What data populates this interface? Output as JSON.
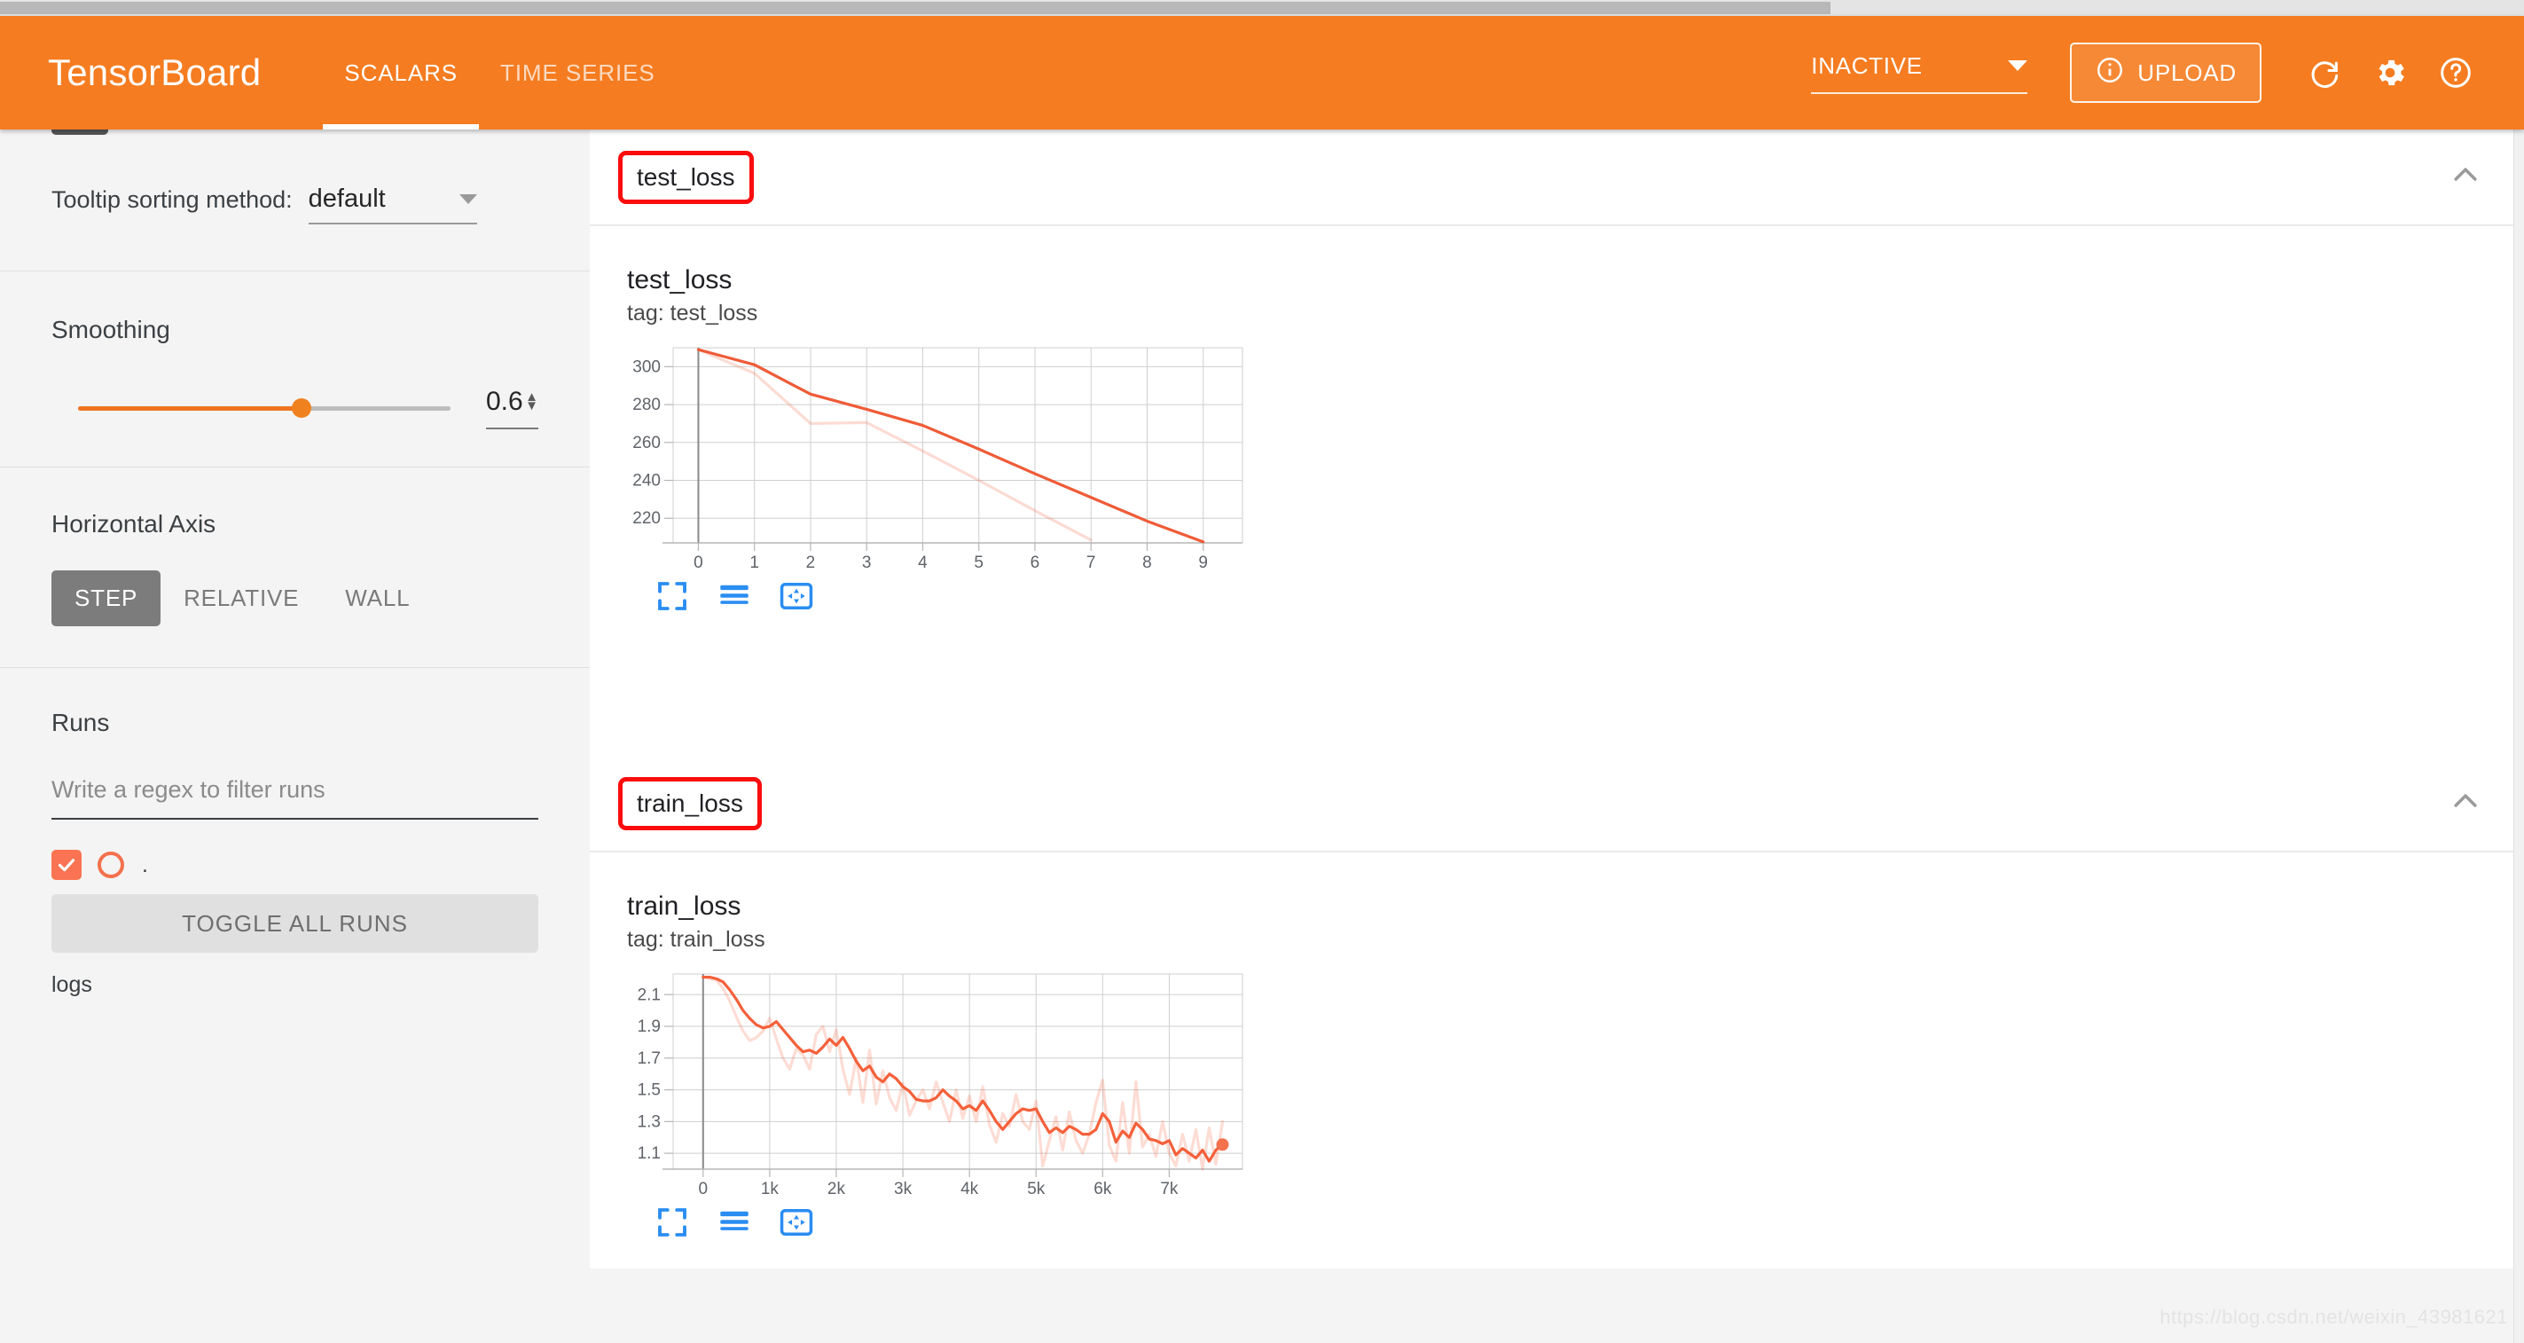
{
  "browser": {
    "top_scrollbar": "horizontal-scrollbar"
  },
  "header": {
    "brand": "TensorBoard",
    "tabs": [
      {
        "label": "SCALARS",
        "active": true
      },
      {
        "label": "TIME SERIES",
        "active": false
      }
    ],
    "status_select": {
      "value": "INACTIVE"
    },
    "upload_label": "UPLOAD",
    "icons": [
      {
        "name": "refresh-icon"
      },
      {
        "name": "settings-gear-icon"
      },
      {
        "name": "help-question-icon"
      }
    ],
    "accent_color": "#f57c20"
  },
  "sidebar": {
    "tooltip_sorting": {
      "label": "Tooltip sorting method:",
      "value": "default"
    },
    "smoothing": {
      "title": "Smoothing",
      "value": "0.6",
      "slider_percent": 60
    },
    "horizontal_axis": {
      "title": "Horizontal Axis",
      "options": [
        {
          "label": "STEP",
          "active": true
        },
        {
          "label": "RELATIVE",
          "active": false
        },
        {
          "label": "WALL",
          "active": false
        }
      ]
    },
    "runs": {
      "title": "Runs",
      "filter_placeholder": "Write a regex to filter runs",
      "filter_value": "",
      "run_items": [
        {
          "name": ".",
          "checked": true,
          "color": "#f4714e"
        }
      ],
      "toggle_all_label": "TOGGLE ALL RUNS",
      "logs_label": "logs"
    }
  },
  "main": {
    "sections": [
      {
        "tag_name": "test_loss",
        "chart": {
          "title": "test_loss",
          "subtitle": "tag: test_loss"
        }
      },
      {
        "tag_name": "train_loss",
        "chart": {
          "title": "train_loss",
          "subtitle": "tag: train_loss"
        }
      }
    ]
  },
  "watermark": "https://blog.csdn.net/weixin_43981621",
  "chart_data": [
    {
      "type": "line",
      "title": "test_loss",
      "subtitle": "tag: test_loss",
      "xlabel": "",
      "ylabel": "",
      "xlim": [
        -0.45,
        9.7
      ],
      "ylim": [
        207,
        310
      ],
      "xticks": [
        0,
        1,
        2,
        3,
        4,
        5,
        6,
        7,
        8,
        9
      ],
      "xticklabels": [
        "0",
        "1",
        "2",
        "3",
        "4",
        "5",
        "6",
        "7",
        "8",
        "9"
      ],
      "yticks": [
        220,
        240,
        260,
        280,
        300
      ],
      "yticklabels": [
        "220",
        "240",
        "260",
        "280",
        "300"
      ],
      "grid": true,
      "legend": false,
      "series": [
        {
          "name": "test_loss (smoothed)",
          "color": "#ef5b37",
          "opacity": 1,
          "x": [
            0,
            1,
            2,
            3,
            4,
            5,
            6,
            7,
            8,
            9
          ],
          "values": [
            309,
            301,
            285.5,
            277.5,
            269,
            256.5,
            243.5,
            231,
            218.5,
            207.5
          ]
        },
        {
          "name": "test_loss (raw)",
          "color": "#ef5b37",
          "opacity": 0.22,
          "x": [
            0,
            1,
            2,
            3,
            4,
            5,
            6,
            7
          ],
          "values": [
            309,
            296.5,
            270,
            270.5,
            255.5,
            240,
            224,
            208.5
          ]
        }
      ]
    },
    {
      "type": "line",
      "title": "train_loss",
      "subtitle": "tag: train_loss",
      "xlabel": "",
      "ylabel": "",
      "xlim": [
        -450,
        8100
      ],
      "ylim": [
        1.0,
        2.23
      ],
      "xticks": [
        0,
        1000,
        2000,
        3000,
        4000,
        5000,
        6000,
        7000
      ],
      "xticklabels": [
        "0",
        "1k",
        "2k",
        "3k",
        "4k",
        "5k",
        "6k",
        "7k"
      ],
      "yticks": [
        1.1,
        1.3,
        1.5,
        1.7,
        1.9,
        2.1
      ],
      "yticklabels": [
        "1.1",
        "1.3",
        "1.5",
        "1.7",
        "1.9",
        "2.1"
      ],
      "grid": true,
      "legend": false,
      "last_point_marker": {
        "x": 7800,
        "y": 1.155,
        "color": "#f4714e"
      },
      "series": [
        {
          "name": "train_loss (smoothed)",
          "color": "#f4603a",
          "opacity": 1,
          "x": [
            0,
            100,
            200,
            300,
            400,
            500,
            600,
            700,
            800,
            900,
            1000,
            1100,
            1200,
            1300,
            1400,
            1500,
            1600,
            1700,
            1800,
            1900,
            2000,
            2100,
            2200,
            2300,
            2400,
            2500,
            2600,
            2700,
            2800,
            2900,
            3000,
            3100,
            3200,
            3300,
            3400,
            3500,
            3600,
            3700,
            3800,
            3900,
            4000,
            4100,
            4200,
            4300,
            4400,
            4500,
            4600,
            4700,
            4800,
            4900,
            5000,
            5100,
            5200,
            5300,
            5400,
            5500,
            5600,
            5700,
            5800,
            5900,
            6000,
            6100,
            6200,
            6300,
            6400,
            6500,
            6600,
            6700,
            6800,
            6900,
            7000,
            7100,
            7200,
            7300,
            7400,
            7500,
            7600,
            7700,
            7800
          ],
          "values": [
            2.21,
            2.21,
            2.2,
            2.18,
            2.13,
            2.07,
            2.0,
            1.95,
            1.91,
            1.89,
            1.9,
            1.93,
            1.88,
            1.83,
            1.78,
            1.74,
            1.75,
            1.73,
            1.77,
            1.82,
            1.78,
            1.83,
            1.76,
            1.68,
            1.62,
            1.65,
            1.58,
            1.55,
            1.6,
            1.57,
            1.52,
            1.49,
            1.44,
            1.43,
            1.43,
            1.45,
            1.5,
            1.46,
            1.43,
            1.38,
            1.4,
            1.37,
            1.43,
            1.37,
            1.3,
            1.25,
            1.3,
            1.35,
            1.38,
            1.37,
            1.38,
            1.3,
            1.23,
            1.26,
            1.23,
            1.27,
            1.25,
            1.22,
            1.22,
            1.25,
            1.35,
            1.3,
            1.17,
            1.24,
            1.2,
            1.29,
            1.25,
            1.19,
            1.18,
            1.16,
            1.18,
            1.09,
            1.13,
            1.1,
            1.07,
            1.12,
            1.05,
            1.12,
            1.16
          ]
        },
        {
          "name": "train_loss (raw)",
          "color": "#f4603a",
          "opacity": 0.22,
          "x": [
            0,
            100,
            200,
            300,
            400,
            500,
            600,
            700,
            800,
            900,
            1000,
            1100,
            1200,
            1300,
            1400,
            1500,
            1600,
            1700,
            1800,
            1900,
            2000,
            2100,
            2200,
            2300,
            2400,
            2500,
            2600,
            2700,
            2800,
            2900,
            3000,
            3100,
            3200,
            3300,
            3400,
            3500,
            3600,
            3700,
            3800,
            3900,
            4000,
            4100,
            4200,
            4300,
            4400,
            4500,
            4600,
            4700,
            4800,
            4900,
            5000,
            5100,
            5200,
            5300,
            5400,
            5500,
            5600,
            5700,
            5800,
            5900,
            6000,
            6100,
            6200,
            6300,
            6400,
            6500,
            6600,
            6700,
            6800,
            6900,
            7000,
            7100,
            7200,
            7300,
            7400,
            7500,
            7600,
            7700,
            7800
          ],
          "values": [
            2.21,
            2.2,
            2.19,
            2.14,
            2.06,
            1.96,
            1.87,
            1.81,
            1.83,
            1.87,
            1.95,
            1.82,
            1.7,
            1.63,
            1.76,
            1.72,
            1.63,
            1.85,
            1.9,
            1.74,
            1.88,
            1.63,
            1.47,
            1.7,
            1.42,
            1.75,
            1.41,
            1.62,
            1.45,
            1.37,
            1.54,
            1.34,
            1.43,
            1.5,
            1.38,
            1.55,
            1.42,
            1.3,
            1.5,
            1.32,
            1.46,
            1.3,
            1.52,
            1.28,
            1.17,
            1.35,
            1.27,
            1.47,
            1.3,
            1.25,
            1.43,
            1.02,
            1.18,
            1.33,
            1.12,
            1.36,
            1.18,
            1.1,
            1.22,
            1.42,
            1.56,
            1.15,
            1.05,
            1.42,
            1.1,
            1.55,
            1.14,
            1.22,
            1.08,
            1.3,
            1.1,
            1.02,
            1.22,
            1.05,
            1.25,
            1.0,
            1.26,
            1.03,
            1.3
          ]
        }
      ]
    }
  ],
  "chart_toolbar": [
    {
      "name": "fit-domain-icon"
    },
    {
      "name": "data-series-icon"
    },
    {
      "name": "pan-icon"
    }
  ]
}
